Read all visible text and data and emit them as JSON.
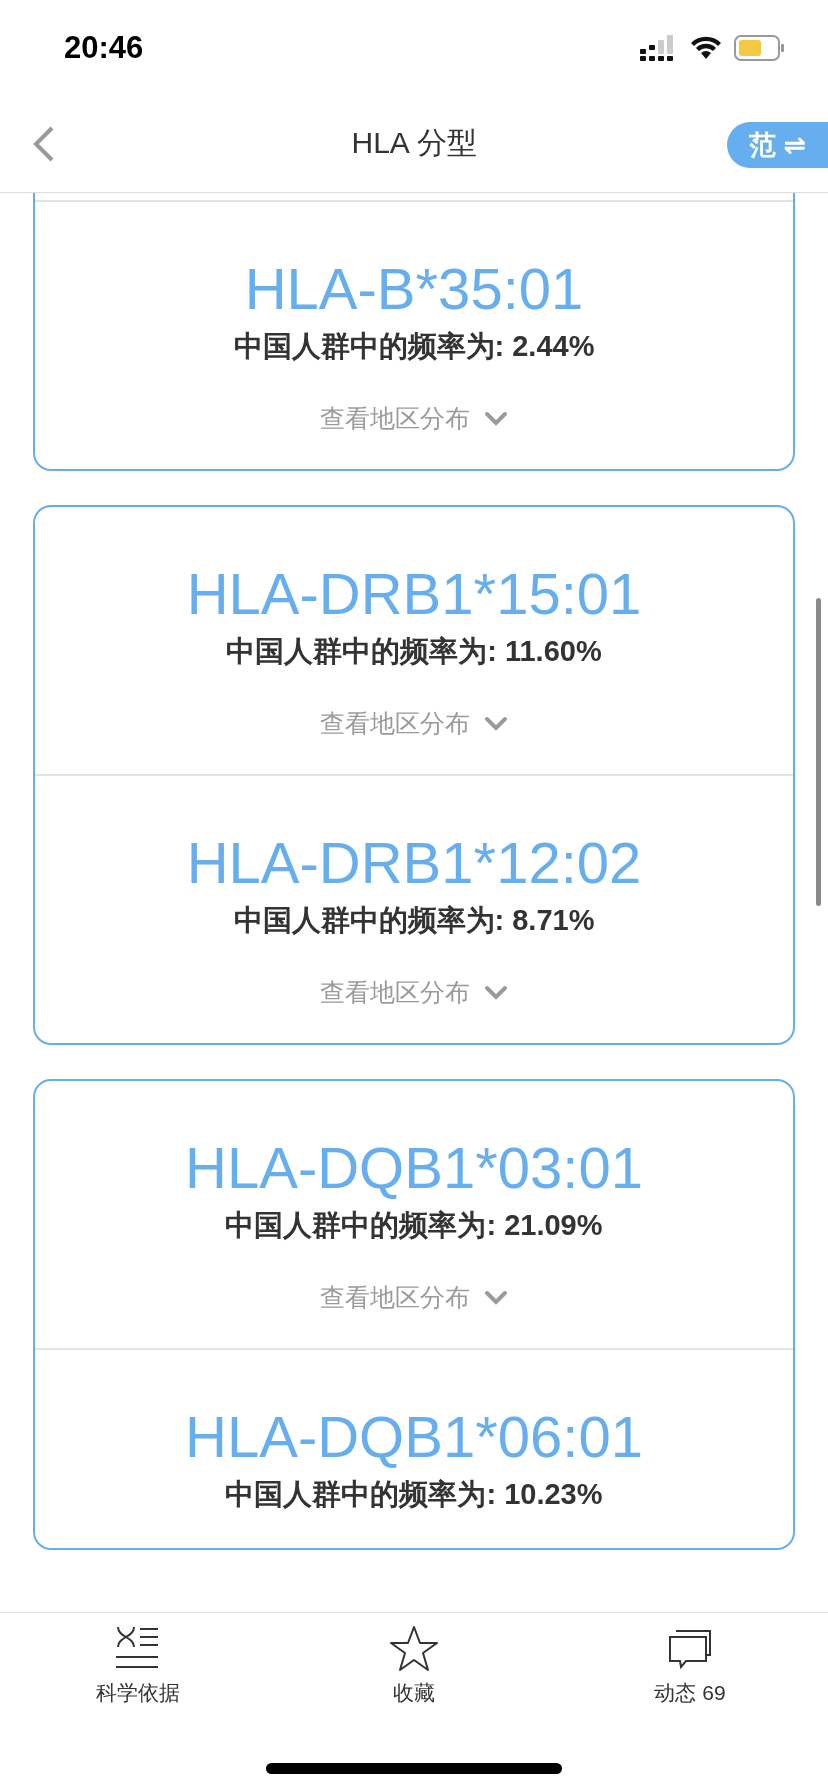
{
  "status_bar": {
    "time": "20:46"
  },
  "header": {
    "title": "HLA 分型",
    "switch_button": "范 ⇌"
  },
  "cards": [
    {
      "continued": true,
      "entries": [
        {
          "allele": "HLA-B*35:01",
          "frequency": "中国人群中的频率为: 2.44%",
          "link": "查看地区分布"
        }
      ]
    },
    {
      "continued": false,
      "entries": [
        {
          "allele": "HLA-DRB1*15:01",
          "frequency": "中国人群中的频率为: 11.60%",
          "link": "查看地区分布"
        },
        {
          "allele": "HLA-DRB1*12:02",
          "frequency": "中国人群中的频率为: 8.71%",
          "link": "查看地区分布"
        }
      ]
    },
    {
      "continued": false,
      "entries": [
        {
          "allele": "HLA-DQB1*03:01",
          "frequency": "中国人群中的频率为: 21.09%",
          "link": "查看地区分布"
        },
        {
          "allele": "HLA-DQB1*06:01",
          "frequency": "中国人群中的频率为: 10.23%"
        }
      ]
    }
  ],
  "tab_bar": [
    {
      "kind": "evidence",
      "label": "科学依据"
    },
    {
      "kind": "favorite",
      "label": "收藏"
    },
    {
      "kind": "activity",
      "label": "动态 69"
    }
  ]
}
